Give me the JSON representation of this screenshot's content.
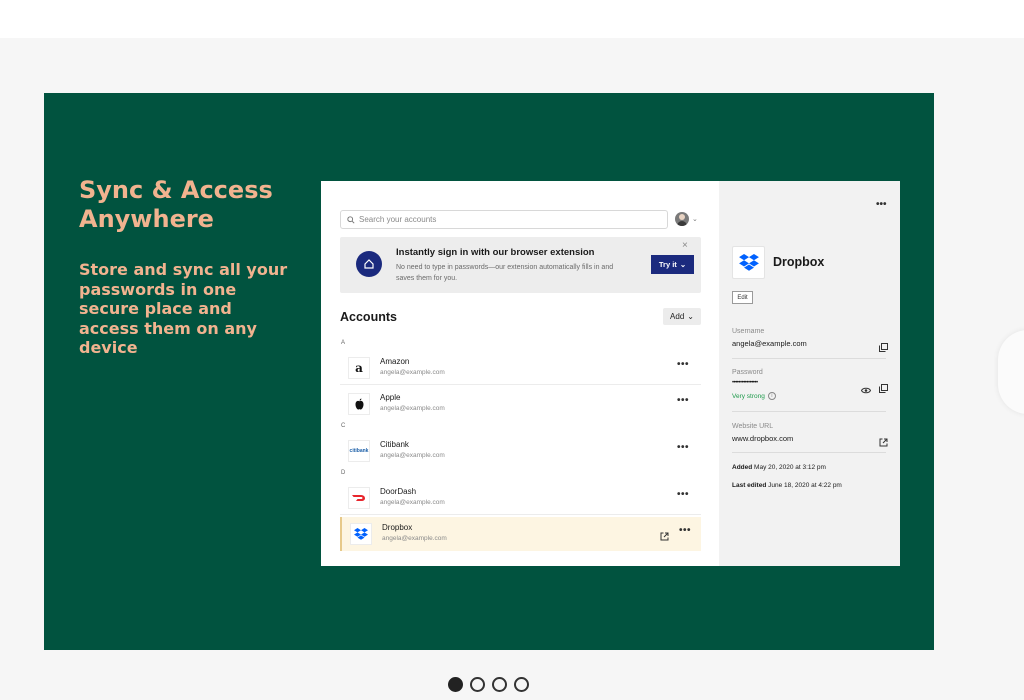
{
  "hero": {
    "title": "Sync & Access Anywhere",
    "text": "Store and sync all your passwords in one secure place and access them on any device"
  },
  "app": {
    "search_placeholder": "Search your accounts",
    "promo": {
      "title": "Instantly sign in with our browser extension",
      "body": "No need to type in passwords—our extension automatically fills in and saves them for you.",
      "button": "Try it",
      "close": "×"
    },
    "accounts_title": "Accounts",
    "add_label": "Add",
    "groups": [
      {
        "letter": "A"
      },
      {
        "letter": "C"
      },
      {
        "letter": "D"
      }
    ],
    "rows": [
      {
        "name": "Amazon",
        "email": "angela@example.com",
        "icon": "amazon-logo"
      },
      {
        "name": "Apple",
        "email": "angela@example.com",
        "icon": "apple-logo"
      },
      {
        "name": "Citibank",
        "email": "angela@example.com",
        "icon": "citibank-logo"
      },
      {
        "name": "DoorDash",
        "email": "angela@example.com",
        "icon": "doordash-logo"
      },
      {
        "name": "Dropbox",
        "email": "angela@example.com",
        "icon": "dropbox-logo"
      }
    ],
    "more": "•••",
    "detail": {
      "name": "Dropbox",
      "edit": "Edit",
      "username_label": "Username",
      "username": "angela@example.com",
      "password_label": "Password",
      "password": "••••••••••••••••",
      "strength": "Very strong",
      "url_label": "Website URL",
      "url": "www.dropbox.com",
      "added_label": "Added",
      "added": "May 20, 2020 at 3:12 pm",
      "edited_label": "Last edited",
      "edited": "June 18, 2020 at 4:22 pm"
    }
  },
  "carousel": {
    "pages": 4,
    "active": 0
  },
  "colors": {
    "banner": "#01533f",
    "accent": "#f1b38f",
    "brand_blue": "#1b2a7e",
    "strength_green": "#1e9a4b"
  }
}
